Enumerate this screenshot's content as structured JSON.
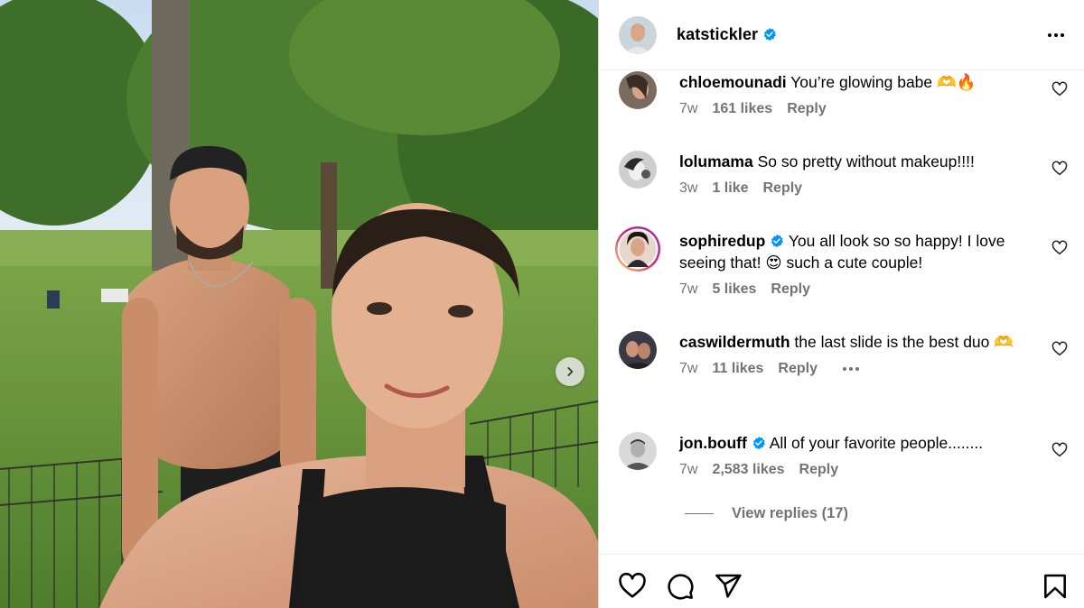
{
  "post": {
    "author": "katstickler",
    "author_verified": true
  },
  "comments": [
    {
      "username": "chloemounadi",
      "text": "You’re glowing babe 🫶🔥",
      "time": "7w",
      "likes": "161 likes",
      "reply": "Reply",
      "verified": false
    },
    {
      "username": "lolumama",
      "text": "So so pretty without makeup!!!!",
      "time": "3w",
      "likes": "1 like",
      "reply": "Reply",
      "verified": false
    },
    {
      "username": "sophiredup",
      "text": "You all look so so happy! I love seeing that! 😍 such a cute couple!",
      "time": "7w",
      "likes": "5 likes",
      "reply": "Reply",
      "verified": true
    },
    {
      "username": "caswildermuth",
      "text": "the last slide is the best duo 🫶",
      "time": "7w",
      "likes": "11 likes",
      "reply": "Reply",
      "verified": false
    },
    {
      "username": "jon.bouff",
      "text": "All of your favorite people........",
      "time": "7w",
      "likes": "2,583 likes",
      "reply": "Reply",
      "verified": true
    }
  ],
  "view_replies": "View replies (17)",
  "icons": {
    "like": "heart-icon",
    "comment": "comment-icon",
    "share": "share-icon",
    "save": "bookmark-icon",
    "more": "more-icon",
    "next": "chevron-right-icon",
    "verified": "verified-badge-icon"
  },
  "colors": {
    "verified": "#0095f6",
    "muted": "#737373",
    "story_ring": "#d62976"
  }
}
